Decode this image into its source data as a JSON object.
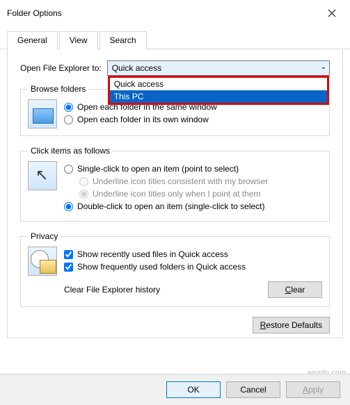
{
  "window": {
    "title": "Folder Options"
  },
  "tabs": {
    "general": "General",
    "view": "View",
    "search": "Search"
  },
  "open_to": {
    "label": "Open File Explorer to:",
    "selected": "Quick access",
    "options": [
      "Quick access",
      "This PC"
    ],
    "highlighted_index": 1
  },
  "browse": {
    "legend": "Browse folders",
    "same_window": "Open each folder in the same window",
    "own_window": "Open each folder in its own window",
    "selected": "same"
  },
  "click": {
    "legend": "Click items as follows",
    "single": "Single-click to open an item (point to select)",
    "underline_browser": "Underline icon titles consistent with my browser",
    "underline_point": "Underline icon titles only when I point at them",
    "double": "Double-click to open an item (single-click to select)",
    "selected": "double"
  },
  "privacy": {
    "legend": "Privacy",
    "recent_files": "Show recently used files in Quick access",
    "frequent_folders": "Show frequently used folders in Quick access",
    "clear_label": "Clear File Explorer history",
    "clear_btn": "Clear"
  },
  "restore_btn": "Restore Defaults",
  "footer": {
    "ok": "OK",
    "cancel": "Cancel",
    "apply": "Apply"
  },
  "watermark": "wsxdn.com"
}
